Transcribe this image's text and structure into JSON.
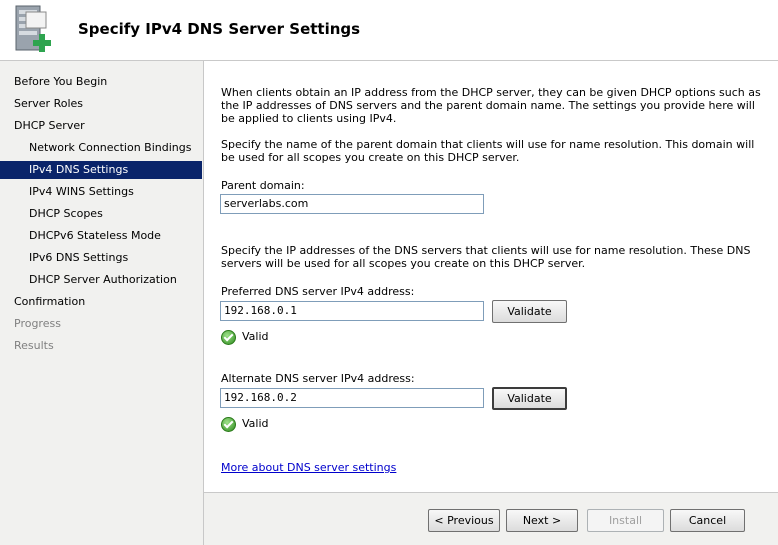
{
  "header": {
    "title": "Specify IPv4 DNS Server Settings",
    "icon": "server-dns-add-icon"
  },
  "sidebar": {
    "items": [
      {
        "label": "Before You Begin"
      },
      {
        "label": "Server Roles"
      },
      {
        "label": "DHCP Server"
      },
      {
        "label": "Network Connection Bindings"
      },
      {
        "label": "IPv4 DNS Settings"
      },
      {
        "label": "IPv4 WINS Settings"
      },
      {
        "label": "DHCP Scopes"
      },
      {
        "label": "DHCPv6 Stateless Mode"
      },
      {
        "label": "IPv6 DNS Settings"
      },
      {
        "label": "DHCP Server Authorization"
      },
      {
        "label": "Confirmation"
      },
      {
        "label": "Progress"
      },
      {
        "label": "Results"
      }
    ],
    "selected": "IPv4 DNS Settings"
  },
  "main": {
    "intro": "When clients obtain an IP address from the DHCP server, they can be given DHCP options such as the IP addresses of DNS servers and the parent domain name. The settings you provide here will be applied to clients using IPv4.",
    "domain_desc": "Specify the name of the parent domain that clients will use for name resolution. This domain will be used for all scopes you create on this DHCP server.",
    "parent_domain_label": "Parent domain:",
    "parent_domain_value": "serverlabs.com",
    "dns_desc": "Specify the IP addresses of the DNS servers that clients will use for name resolution. These DNS servers will be used for all scopes you create on this DHCP server.",
    "preferred_label": "Preferred DNS server IPv4 address:",
    "preferred_value": "192.168.0.1",
    "preferred_validate": "Validate",
    "preferred_status": "Valid",
    "alternate_label": "Alternate DNS server IPv4 address:",
    "alternate_value": "192.168.0.2",
    "alternate_validate": "Validate",
    "alternate_status": "Valid",
    "more_link": "More about DNS server settings"
  },
  "footer": {
    "previous": "< Previous",
    "next": "Next >",
    "install": "Install",
    "cancel": "Cancel"
  },
  "colors": {
    "selection": "#0a246a",
    "link": "#0000cc",
    "valid": "#2e8b1e"
  }
}
